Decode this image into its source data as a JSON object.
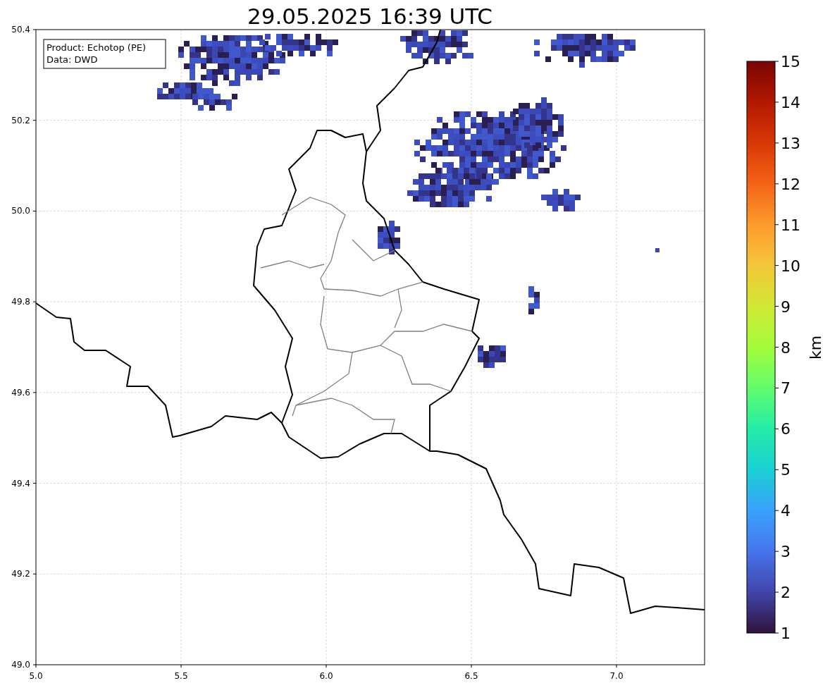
{
  "title": "29.05.2025 16:39 UTC",
  "info_box": [
    "Product: Echotop (PE)",
    "Data: DWD"
  ],
  "map": {
    "x_ticks": [
      "5.0",
      "5.5",
      "6.0",
      "6.5",
      "7.0"
    ],
    "y_ticks": [
      "50.4",
      "50.2",
      "50.0",
      "49.8",
      "49.6",
      "49.4",
      "49.2",
      "49.0"
    ]
  },
  "colorbar": {
    "label": "km",
    "ticks": [
      "15",
      "14",
      "13",
      "12",
      "11",
      "10",
      "9",
      "8",
      "7",
      "6",
      "5",
      "4",
      "3",
      "2",
      "1"
    ]
  }
}
